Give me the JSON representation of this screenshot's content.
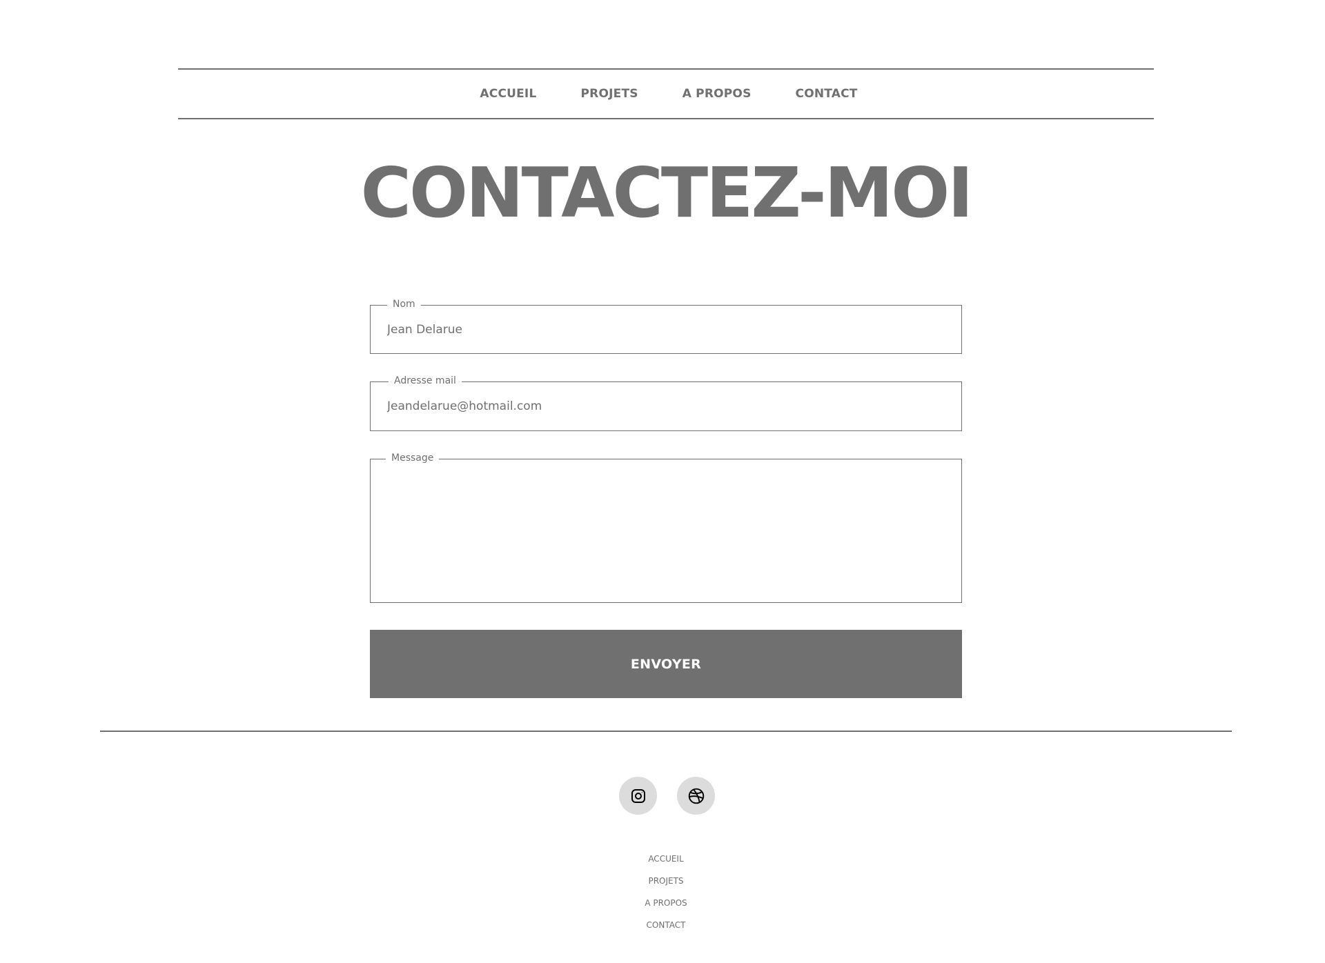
{
  "nav": {
    "items": [
      {
        "label": "ACCUEIL"
      },
      {
        "label": "PROJETS"
      },
      {
        "label": "A PROPOS"
      },
      {
        "label": "CONTACT"
      }
    ]
  },
  "page": {
    "title": "CONTACTEZ-MOI"
  },
  "form": {
    "name": {
      "label": "Nom",
      "value": "Jean Delarue"
    },
    "email": {
      "label": "Adresse mail",
      "value": "Jeandelarue@hotmail.com"
    },
    "message": {
      "label": "Message",
      "value": ""
    },
    "submit_label": "ENVOYER"
  },
  "social": {
    "icons": [
      "instagram-icon",
      "dribbble-icon"
    ],
    "button_bg": "#dcdcdc"
  },
  "footer": {
    "links": [
      {
        "label": "ACCUEIL"
      },
      {
        "label": "PROJETS"
      },
      {
        "label": "A PROPOS"
      },
      {
        "label": "CONTACT"
      }
    ]
  },
  "colors": {
    "primary_gray": "#707070",
    "background": "#ffffff",
    "button_text": "#ffffff"
  }
}
